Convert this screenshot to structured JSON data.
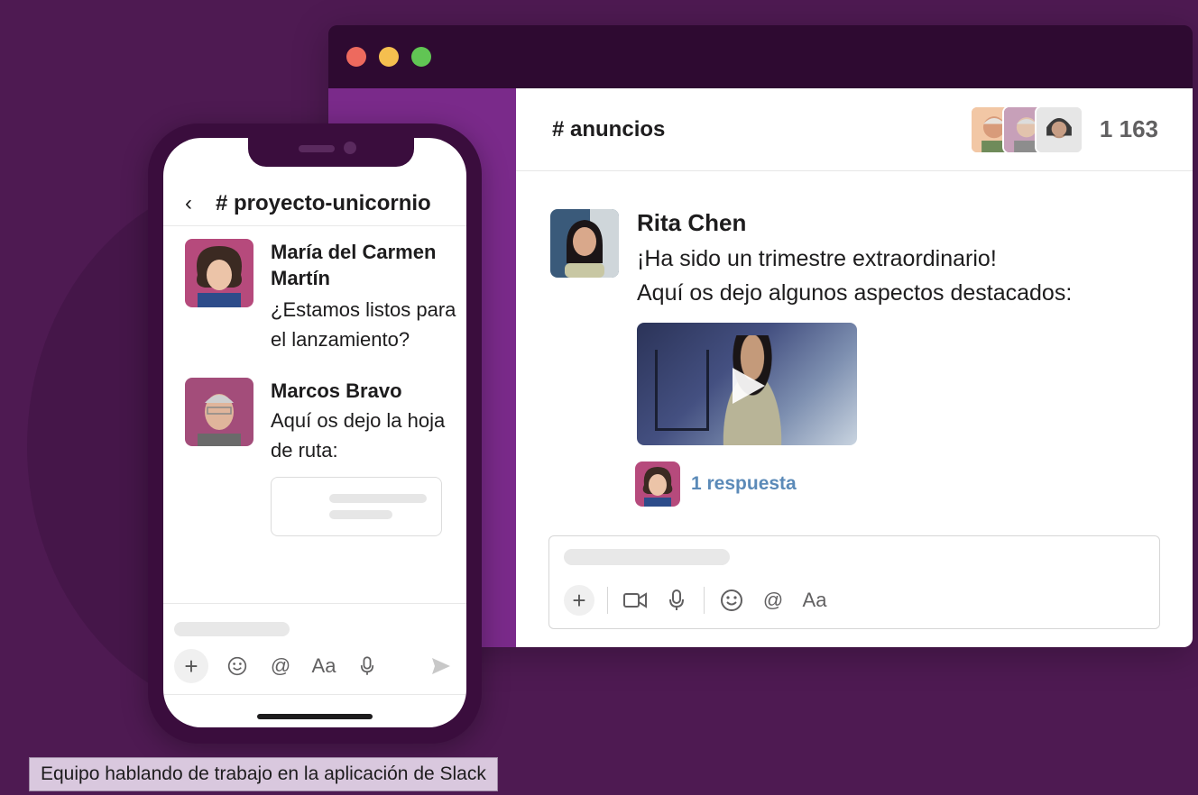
{
  "window": {
    "channel_title": "# anuncios",
    "member_count": "1 163",
    "message": {
      "author": "Rita Chen",
      "line1": "¡Ha sido un trimestre extraordinario!",
      "line2": "Aquí os dejo algunos aspectos destacados:",
      "reply_text": "1 respuesta"
    },
    "composer_tools": [
      "plus-icon",
      "video-icon",
      "microphone-icon",
      "emoji-icon",
      "mention-icon",
      "format-icon"
    ],
    "format_label": "Aa"
  },
  "phone": {
    "channel_title": "# proyecto-unicornio",
    "messages": [
      {
        "author": "María del Carmen Martín",
        "text": "¿Estamos listos para el lanzamiento?"
      },
      {
        "author": "Marcos Bravo",
        "text": "Aquí os dejo la hoja de ruta:"
      }
    ],
    "format_label": "Aa"
  },
  "caption": "Equipo hablando de trabajo en la aplicación de Slack",
  "colors": {
    "background": "#4e1a52",
    "sidebar": "#7a2a8a",
    "link": "#5b8ab8"
  }
}
